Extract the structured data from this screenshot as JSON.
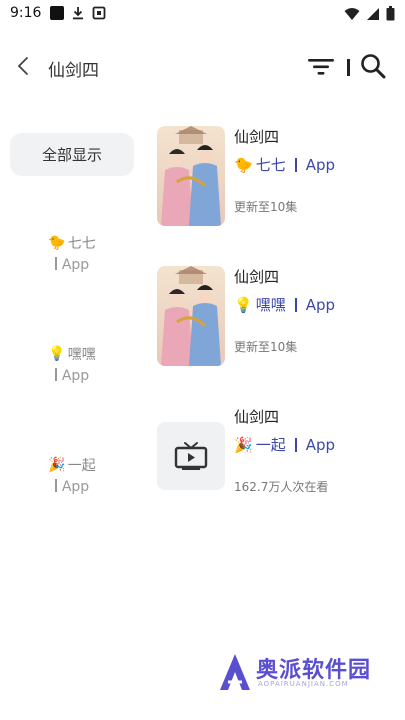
{
  "status_bar": {
    "time": "9:16"
  },
  "header": {
    "title": "仙剑四"
  },
  "filters": {
    "show_all_label": "全部显示",
    "sources": [
      {
        "emoji": "🐤",
        "name": "七七",
        "type": "App"
      },
      {
        "emoji": "💡",
        "name": "嘿嘿",
        "type": "App"
      },
      {
        "emoji": "🎉",
        "name": "一起",
        "type": "App"
      }
    ]
  },
  "results": [
    {
      "title": "仙剑四",
      "source_emoji": "🐤",
      "source_name": "七七",
      "source_type": "App",
      "subtitle": "更新至10集",
      "poster": "drama-poster"
    },
    {
      "title": "仙剑四",
      "source_emoji": "💡",
      "source_name": "嘿嘿",
      "source_type": "App",
      "subtitle": "更新至10集",
      "poster": "drama-poster"
    },
    {
      "title": "仙剑四",
      "source_emoji": "🎉",
      "source_name": "一起",
      "source_type": "App",
      "subtitle": "162.7万人次在看",
      "poster": "tv-placeholder-icon"
    }
  ],
  "watermark": {
    "text": "奥派软件园",
    "sub": "AOPAIRUANJIAN.COM"
  },
  "colors": {
    "accent": "#3b48a8",
    "chip_bg": "#f1f2f4",
    "watermark": "#5a4fd0"
  }
}
